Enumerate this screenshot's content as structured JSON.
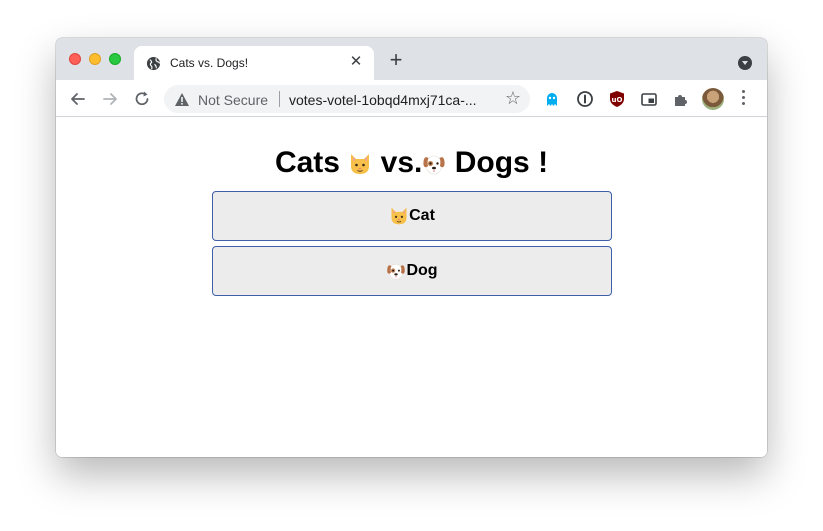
{
  "browser": {
    "tab": {
      "title": "Cats vs. Dogs!"
    },
    "new_tab_label": "+",
    "tab_close_glyph": "✕",
    "omnibox": {
      "security_label": "Not Secure",
      "url": "votes-votel-1obqd4mxj71ca-...",
      "star_glyph": "☆"
    },
    "icons": [
      "back-icon",
      "forward-icon",
      "reload-icon",
      "warning-icon",
      "bookmark-star-icon",
      "ghostery-icon",
      "1password-icon",
      "ublock-origin-icon",
      "picture-in-picture-icon",
      "extensions-puzzle-icon",
      "profile-avatar",
      "menu-kebab-icon"
    ]
  },
  "page": {
    "heading": {
      "part1": "Cats",
      "part2": "vs.",
      "part3": "Dogs",
      "part4": "!"
    },
    "buttons": {
      "cat_label": "Cat",
      "dog_label": "Dog"
    }
  },
  "colors": {
    "tab_strip": "#dee1e6",
    "button_bg": "#ececec",
    "button_border": "#3f5fa8",
    "traffic_close": "#fe5f57",
    "traffic_min": "#febc2e",
    "traffic_max": "#28c840"
  }
}
